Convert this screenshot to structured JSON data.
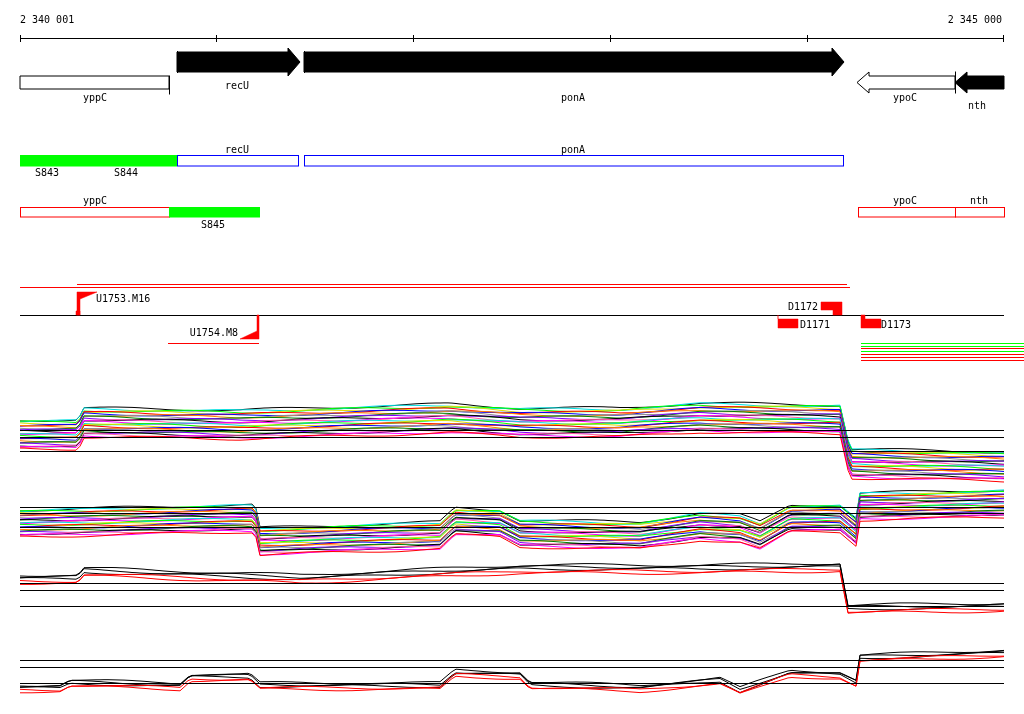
{
  "ruler": {
    "start": "2 340 001",
    "end": "2 345 000"
  },
  "genes": [
    {
      "name": "yppC",
      "filled": false,
      "kind": "box"
    },
    {
      "name": "recU",
      "filled": true,
      "kind": "forward"
    },
    {
      "name": "ponA",
      "filled": true,
      "kind": "forward"
    },
    {
      "name": "ypoC",
      "filled": false,
      "kind": "reverse"
    },
    {
      "name": "nth",
      "filled": true,
      "kind": "reverse"
    }
  ],
  "annotation_track_1": [
    {
      "label": "recU",
      "kind": "gene"
    },
    {
      "label": "ponA",
      "kind": "gene"
    },
    {
      "label": "S843",
      "kind": "segment"
    },
    {
      "label": "S844",
      "kind": "segment"
    }
  ],
  "annotation_track_2": [
    {
      "label": "yppC",
      "kind": "gene"
    },
    {
      "label": "S845",
      "kind": "segment"
    },
    {
      "label": "ypoC",
      "kind": "gene"
    },
    {
      "label": "nth",
      "kind": "gene"
    }
  ],
  "markers": [
    {
      "label": "U1753.M16",
      "kind": "flag"
    },
    {
      "label": "U1754.M8",
      "kind": "flag"
    },
    {
      "label": "D1172",
      "kind": "block"
    },
    {
      "label": "D1171",
      "kind": "block"
    },
    {
      "label": "D1173",
      "kind": "block"
    }
  ]
}
